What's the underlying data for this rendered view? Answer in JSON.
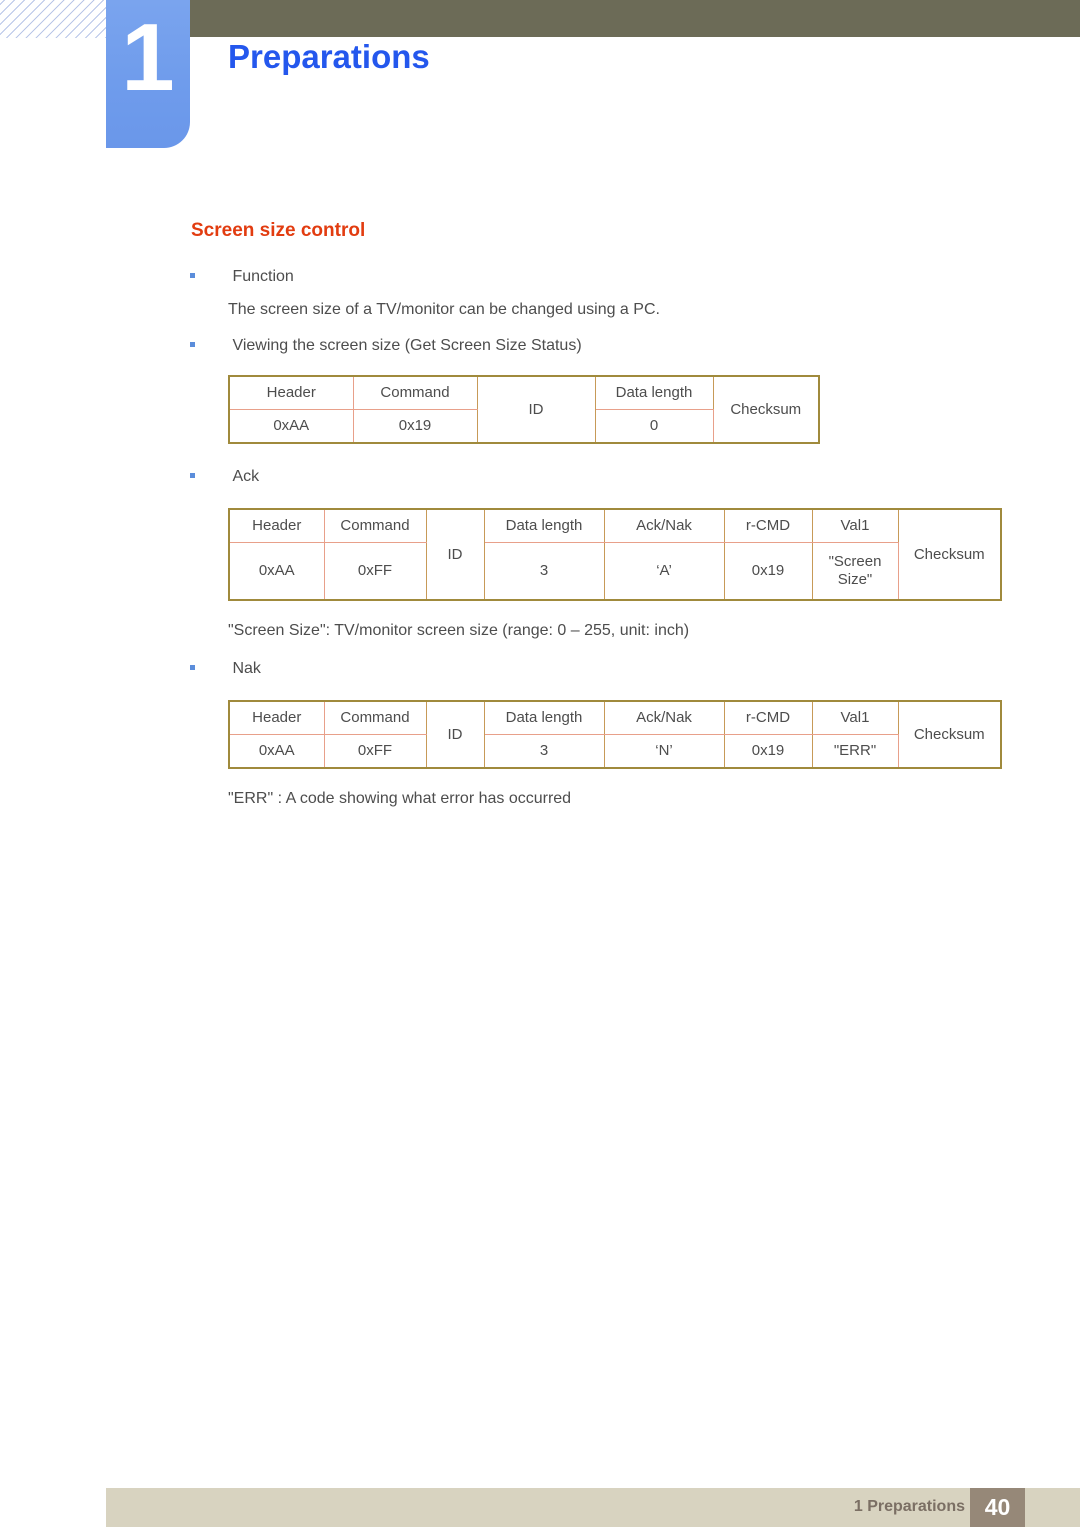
{
  "header": {
    "chapter_number": "1",
    "chapter_title": "Preparations"
  },
  "section": {
    "heading": "Screen size control"
  },
  "body": {
    "bullet_function": "Function",
    "function_description": "The screen size of a TV/monitor can be changed using a PC.",
    "bullet_viewing": "Viewing the screen size (Get Screen Size Status)",
    "bullet_ack": "Ack",
    "screen_size_note": "\"Screen Size\": TV/monitor screen size (range: 0 – 255, unit: inch)",
    "bullet_nak": "Nak",
    "err_note": "\"ERR\" : A code showing what error has occurred"
  },
  "tables": {
    "get_status": {
      "headers": [
        "Header",
        "Command",
        "ID",
        "Data length",
        "Checksum"
      ],
      "values": [
        "0xAA",
        "0x19",
        "ID",
        "0",
        "Checksum"
      ]
    },
    "ack": {
      "headers": [
        "Header",
        "Command",
        "ID",
        "Data length",
        "Ack/Nak",
        "r-CMD",
        "Val1",
        "Checksum"
      ],
      "values": [
        "0xAA",
        "0xFF",
        "ID",
        "3",
        "‘A’",
        "0x19",
        "\"Screen Size\"",
        "Checksum"
      ]
    },
    "nak": {
      "headers": [
        "Header",
        "Command",
        "ID",
        "Data length",
        "Ack/Nak",
        "r-CMD",
        "Val1",
        "Checksum"
      ],
      "values": [
        "0xAA",
        "0xFF",
        "ID",
        "3",
        "‘N’",
        "0x19",
        "\"ERR\"",
        "Checksum"
      ]
    }
  },
  "footer": {
    "label": "1 Preparations",
    "page_number": "40"
  },
  "colors": {
    "title_blue": "#2457ed",
    "heading_orange": "#e23c10",
    "olive_bar": "#6c6b57",
    "tab_blue": "#6f9cec",
    "footer_band": "#d8d3c0",
    "footer_page_box": "#968878",
    "table_border_outer": "#a08a3c",
    "table_border_inner": "#e8a08a"
  }
}
